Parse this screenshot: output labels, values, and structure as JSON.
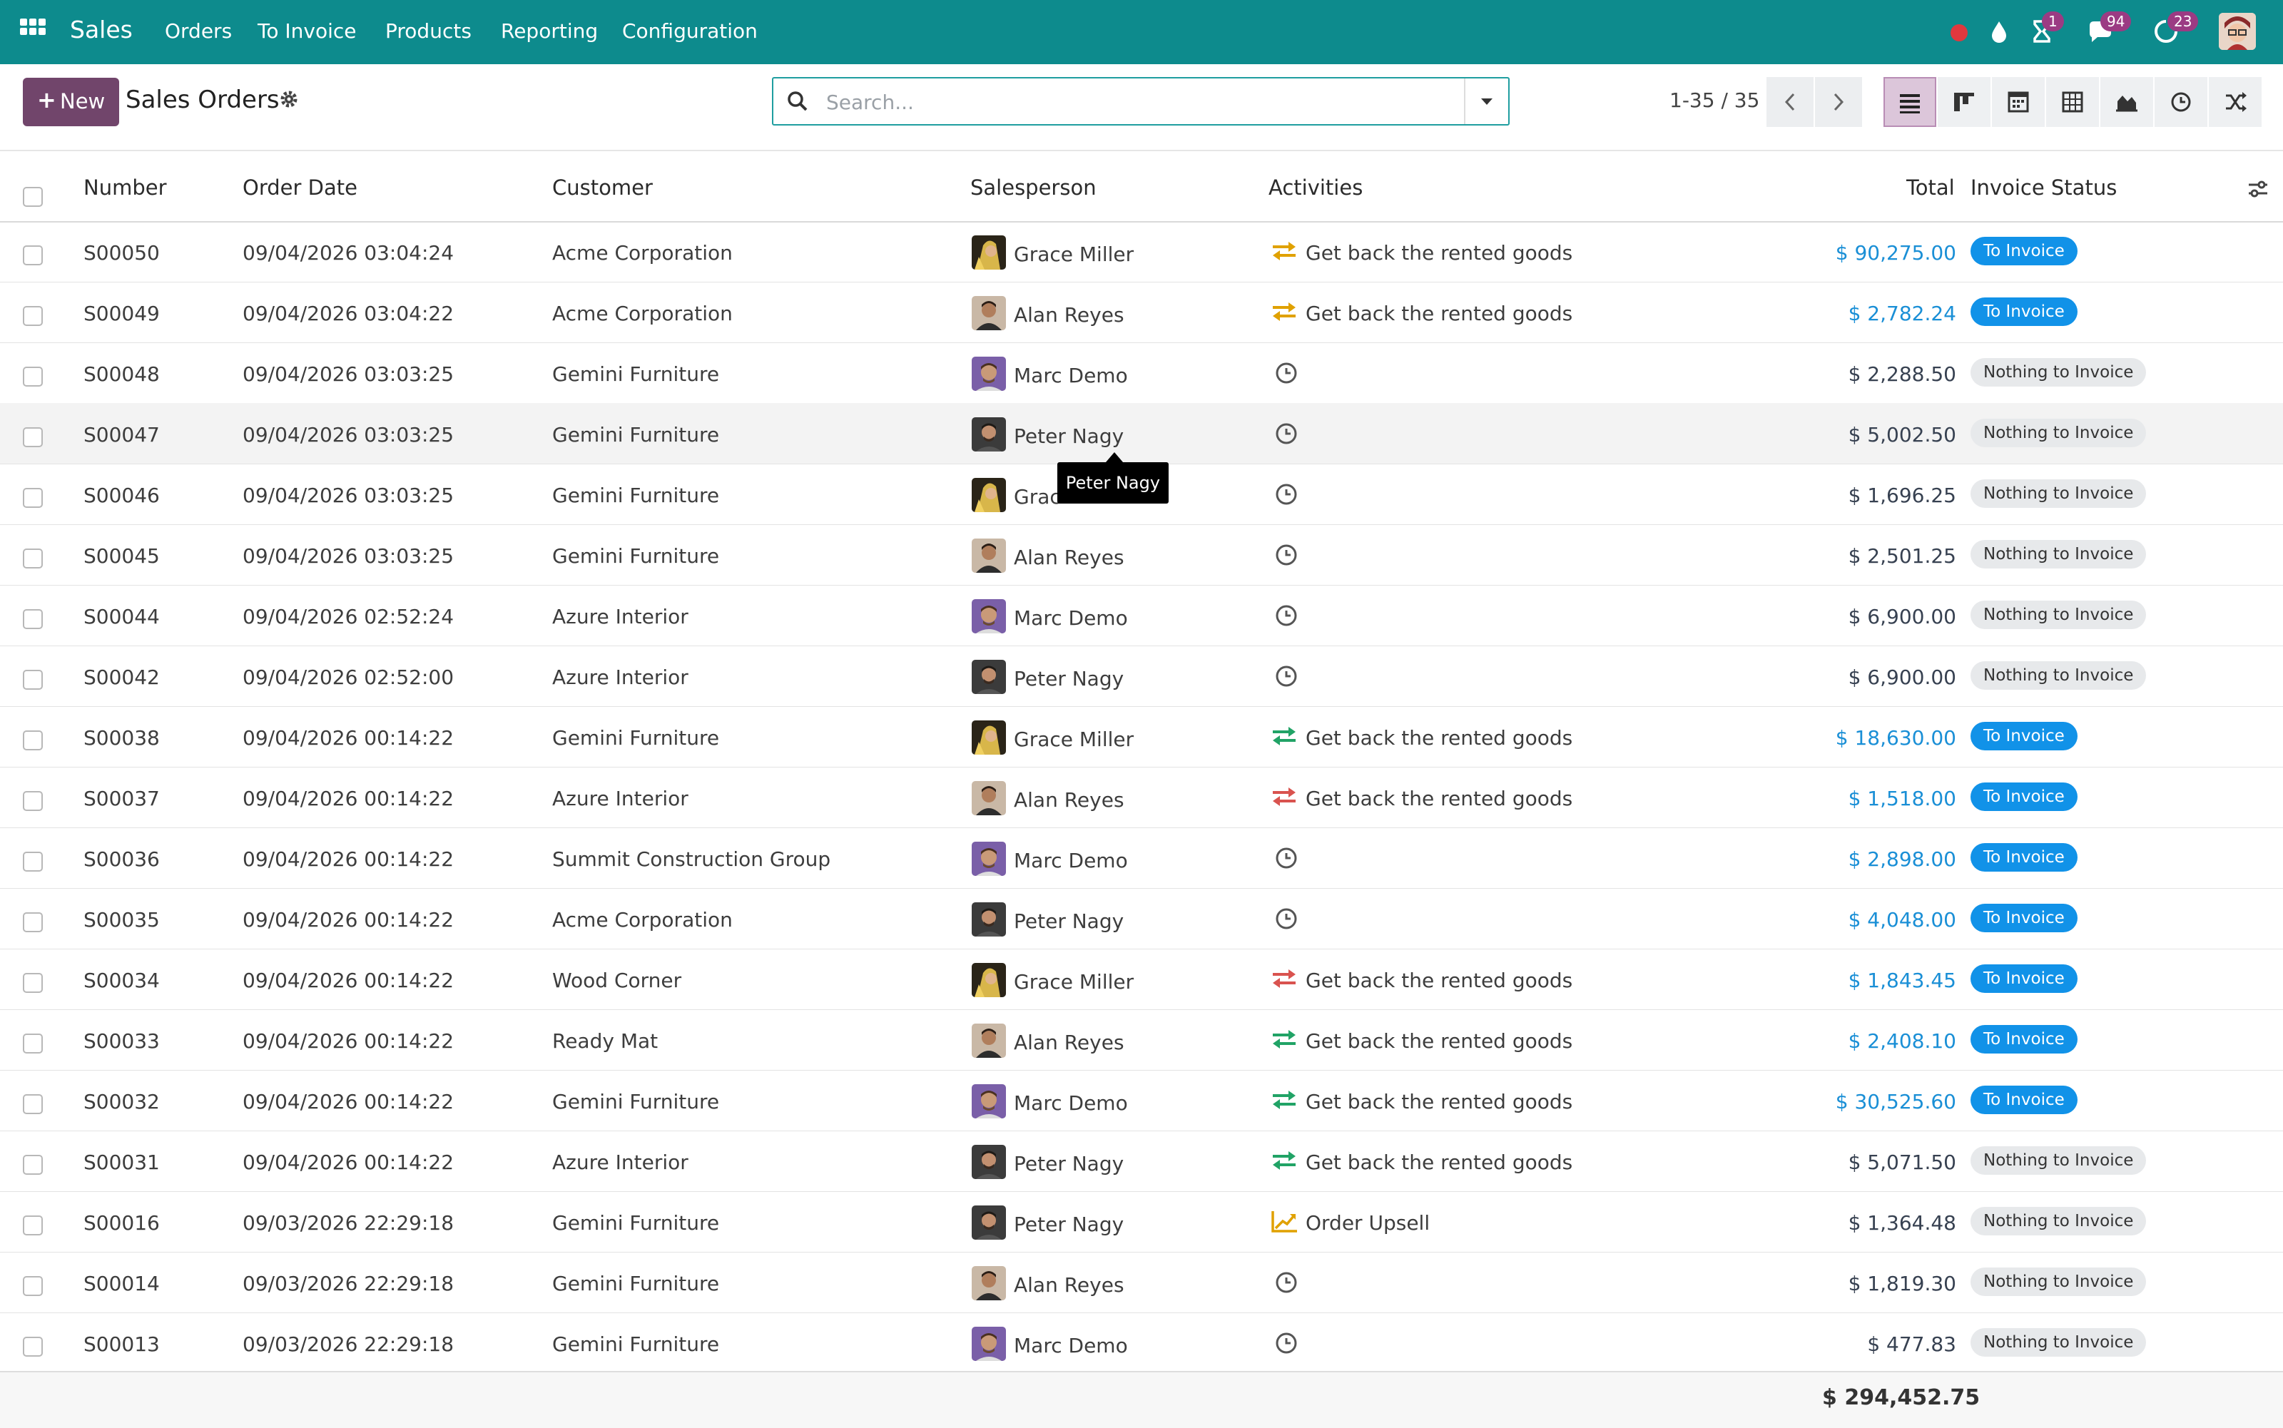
{
  "app": {
    "brand": "Sales",
    "menu": [
      "Orders",
      "To Invoice",
      "Products",
      "Reporting",
      "Configuration"
    ],
    "badges": {
      "activities": "1",
      "messages": "94",
      "updates": "23"
    }
  },
  "toolbar": {
    "new_label": "New",
    "title": "Sales Orders",
    "search_placeholder": "Search...",
    "pager": "1-35 / 35"
  },
  "table": {
    "headers": {
      "number": "Number",
      "order_date": "Order Date",
      "customer": "Customer",
      "salesperson": "Salesperson",
      "activities": "Activities",
      "total": "Total",
      "invoice_status": "Invoice Status"
    },
    "rows": [
      {
        "number": "S00050",
        "date": "09/04/2026 03:04:24",
        "customer": "Acme Corporation",
        "salesperson": "Grace Miller",
        "activity": "Get back the rented goods",
        "activity_icon": "exchange-icon",
        "total": "$ 90,275.00",
        "status": "To Invoice"
      },
      {
        "number": "S00049",
        "date": "09/04/2026 03:04:22",
        "customer": "Acme Corporation",
        "salesperson": "Alan Reyes",
        "activity": "Get back the rented goods",
        "activity_icon": "exchange-icon",
        "total": "$ 2,782.24",
        "status": "To Invoice"
      },
      {
        "number": "S00048",
        "date": "09/04/2026 03:03:25",
        "customer": "Gemini Furniture",
        "salesperson": "Marc Demo",
        "activity": "",
        "activity_icon": "clock-icon",
        "total": "$ 2,288.50",
        "status": "Nothing to Invoice"
      },
      {
        "number": "S00047",
        "date": "09/04/2026 03:03:25",
        "customer": "Gemini Furniture",
        "salesperson": "Peter Nagy",
        "activity": "",
        "activity_icon": "clock-icon",
        "total": "$ 5,002.50",
        "status": "Nothing to Invoice"
      },
      {
        "number": "S00046",
        "date": "09/04/2026 03:03:25",
        "customer": "Gemini Furniture",
        "salesperson": "Grac",
        "activity": "",
        "activity_icon": "clock-icon",
        "total": "$ 1,696.25",
        "status": "Nothing to Invoice"
      },
      {
        "number": "S00045",
        "date": "09/04/2026 03:03:25",
        "customer": "Gemini Furniture",
        "salesperson": "Alan Reyes",
        "activity": "",
        "activity_icon": "clock-icon",
        "total": "$ 2,501.25",
        "status": "Nothing to Invoice"
      },
      {
        "number": "S00044",
        "date": "09/04/2026 02:52:24",
        "customer": "Azure Interior",
        "salesperson": "Marc Demo",
        "activity": "",
        "activity_icon": "clock-icon",
        "total": "$ 6,900.00",
        "status": "Nothing to Invoice"
      },
      {
        "number": "S00042",
        "date": "09/04/2026 02:52:00",
        "customer": "Azure Interior",
        "salesperson": "Peter Nagy",
        "activity": "",
        "activity_icon": "clock-icon",
        "total": "$ 6,900.00",
        "status": "Nothing to Invoice"
      },
      {
        "number": "S00038",
        "date": "09/04/2026 00:14:22",
        "customer": "Gemini Furniture",
        "salesperson": "Grace Miller",
        "activity": "Get back the rented goods",
        "activity_icon": "exchange-icon",
        "total": "$ 18,630.00",
        "status": "To Invoice"
      },
      {
        "number": "S00037",
        "date": "09/04/2026 00:14:22",
        "customer": "Azure Interior",
        "salesperson": "Alan Reyes",
        "activity": "Get back the rented goods",
        "activity_icon": "exchange-icon",
        "total": "$ 1,518.00",
        "status": "To Invoice"
      },
      {
        "number": "S00036",
        "date": "09/04/2026 00:14:22",
        "customer": "Summit Construction Group",
        "salesperson": "Marc Demo",
        "activity": "",
        "activity_icon": "clock-icon",
        "total": "$ 2,898.00",
        "status": "To Invoice"
      },
      {
        "number": "S00035",
        "date": "09/04/2026 00:14:22",
        "customer": "Acme Corporation",
        "salesperson": "Peter Nagy",
        "activity": "",
        "activity_icon": "clock-icon",
        "total": "$ 4,048.00",
        "status": "To Invoice"
      },
      {
        "number": "S00034",
        "date": "09/04/2026 00:14:22",
        "customer": "Wood Corner",
        "salesperson": "Grace Miller",
        "activity": "Get back the rented goods",
        "activity_icon": "exchange-icon",
        "total": "$ 1,843.45",
        "status": "To Invoice"
      },
      {
        "number": "S00033",
        "date": "09/04/2026 00:14:22",
        "customer": "Ready Mat",
        "salesperson": "Alan Reyes",
        "activity": "Get back the rented goods",
        "activity_icon": "exchange-icon",
        "total": "$ 2,408.10",
        "status": "To Invoice"
      },
      {
        "number": "S00032",
        "date": "09/04/2026 00:14:22",
        "customer": "Gemini Furniture",
        "salesperson": "Marc Demo",
        "activity": "Get back the rented goods",
        "activity_icon": "exchange-icon",
        "total": "$ 30,525.60",
        "status": "To Invoice"
      },
      {
        "number": "S00031",
        "date": "09/04/2026 00:14:22",
        "customer": "Azure Interior",
        "salesperson": "Peter Nagy",
        "activity": "Get back the rented goods",
        "activity_icon": "exchange-icon",
        "total": "$ 5,071.50",
        "status": "Nothing to Invoice"
      },
      {
        "number": "S00016",
        "date": "09/03/2026 22:29:18",
        "customer": "Gemini Furniture",
        "salesperson": "Peter Nagy",
        "activity": "Order Upsell",
        "activity_icon": "trend-up-icon",
        "total": "$ 1,364.48",
        "status": "Nothing to Invoice"
      },
      {
        "number": "S00014",
        "date": "09/03/2026 22:29:18",
        "customer": "Gemini Furniture",
        "salesperson": "Alan Reyes",
        "activity": "",
        "activity_icon": "clock-icon",
        "total": "$ 1,819.30",
        "status": "Nothing to Invoice"
      },
      {
        "number": "S00013",
        "date": "09/03/2026 22:29:18",
        "customer": "Gemini Furniture",
        "salesperson": "Marc Demo",
        "activity": "",
        "activity_icon": "clock-icon",
        "total": "$ 477.83",
        "status": "Nothing to Invoice"
      }
    ],
    "footer_total": "$ 294,452.75"
  },
  "tooltip": "Peter Nagy",
  "colors": {
    "topbar": "#0d8b8d",
    "primary_button": "#71456b",
    "to_invoice_badge": "#1192e8",
    "link_total": "#1a8fd6",
    "activity_warning": "#e0a100",
    "activity_planned": "#21a366",
    "activity_overdue": "#d9534f"
  }
}
